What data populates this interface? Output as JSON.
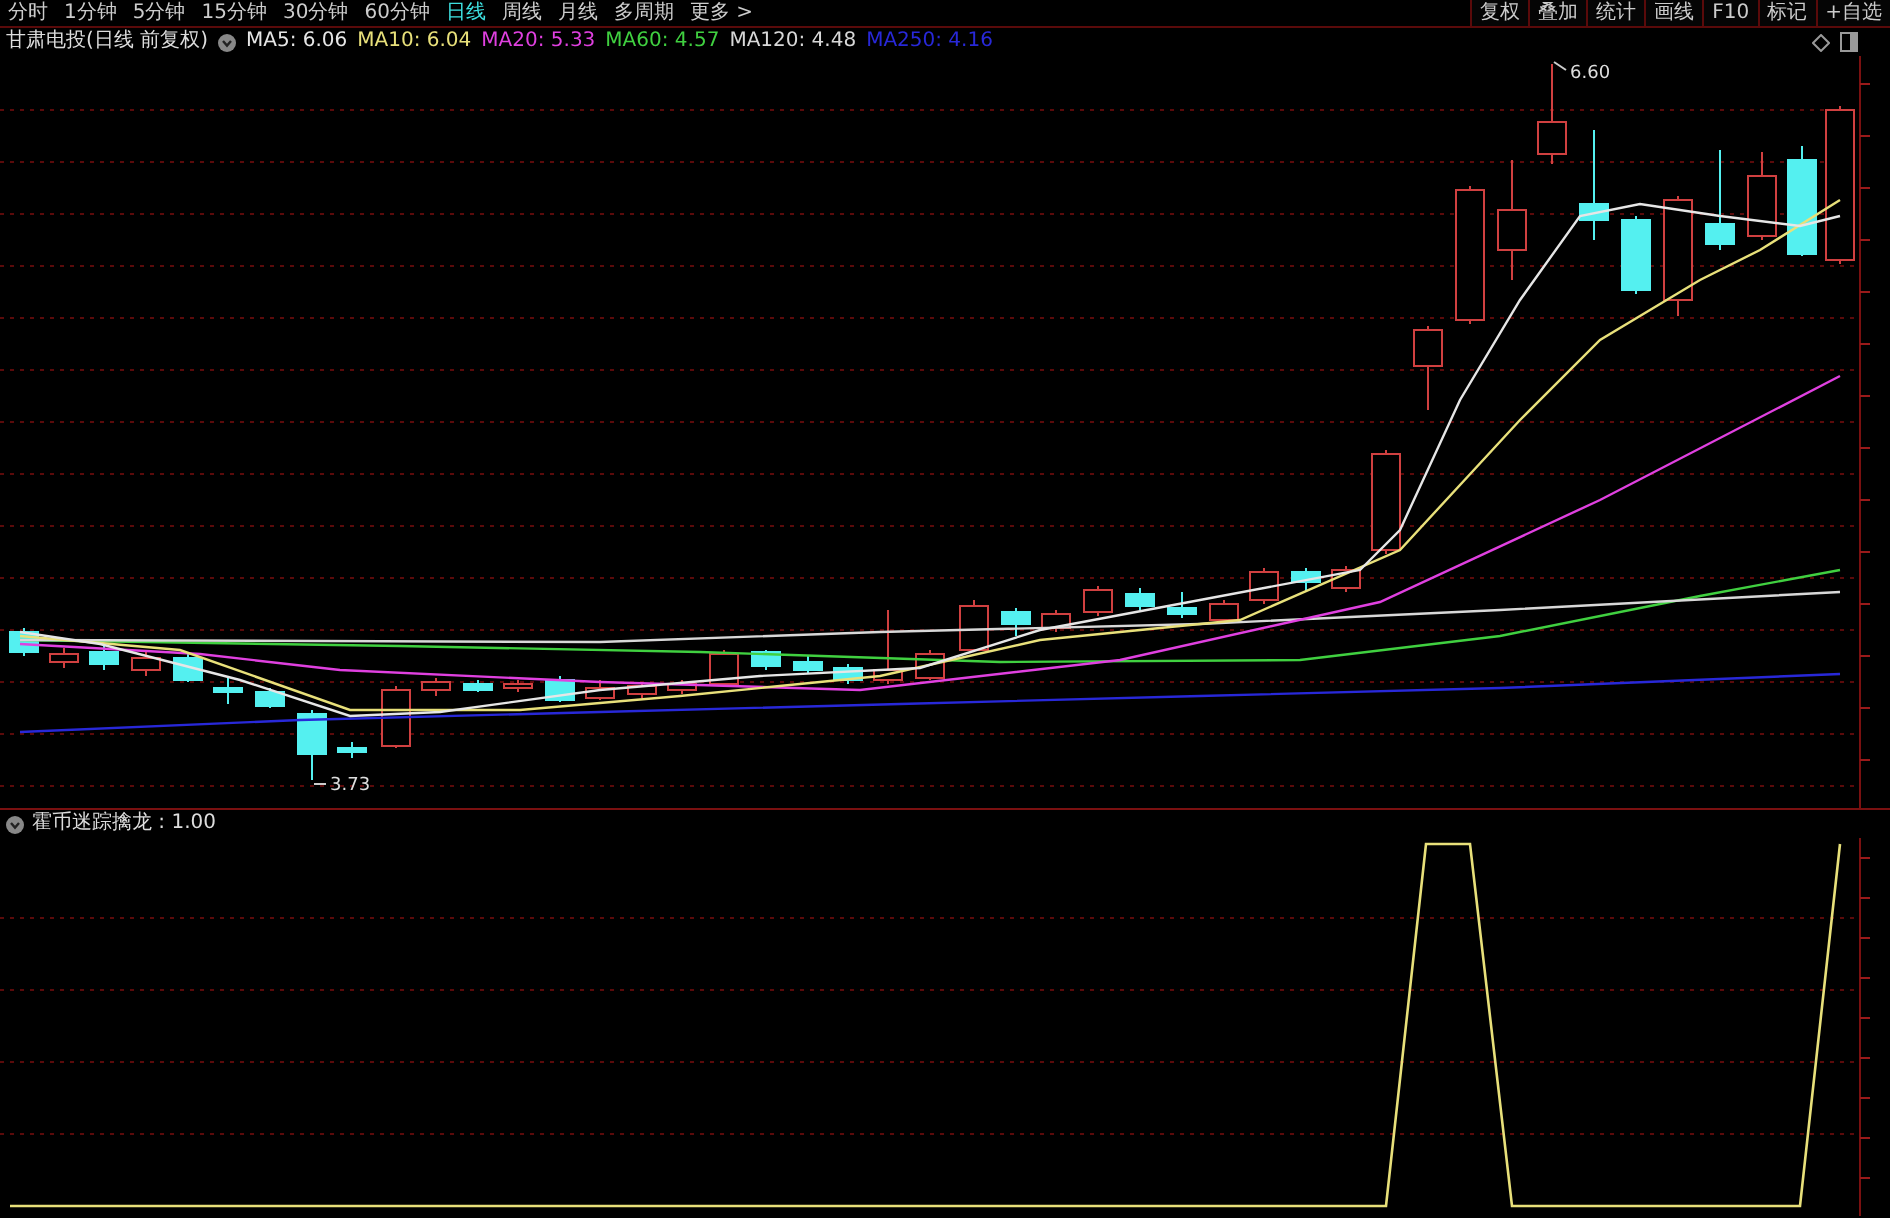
{
  "toolbar": {
    "periods": [
      {
        "label": "分时",
        "selected": false
      },
      {
        "label": "1分钟",
        "selected": false
      },
      {
        "label": "5分钟",
        "selected": false
      },
      {
        "label": "15分钟",
        "selected": false
      },
      {
        "label": "30分钟",
        "selected": false
      },
      {
        "label": "60分钟",
        "selected": false
      },
      {
        "label": "日线",
        "selected": true
      },
      {
        "label": "周线",
        "selected": false
      },
      {
        "label": "月线",
        "selected": false
      },
      {
        "label": "多周期",
        "selected": false
      },
      {
        "label": "更多 >",
        "selected": false
      }
    ],
    "buttons": [
      "复权",
      "叠加",
      "统计",
      "画线",
      "F10",
      "标记",
      "+自选"
    ]
  },
  "legend": {
    "title": "甘肃电投(日线 前复权)",
    "averages": [
      {
        "label": "MA5: 6.06",
        "color": "#e6e6e6"
      },
      {
        "label": "MA10: 6.04",
        "color": "#e8e07a"
      },
      {
        "label": "MA20: 5.33",
        "color": "#e040e0"
      },
      {
        "label": "MA60: 4.57",
        "color": "#40d040"
      },
      {
        "label": "MA120: 4.48",
        "color": "#d8d8d8"
      },
      {
        "label": "MA250: 4.16",
        "color": "#2828d8"
      }
    ]
  },
  "chart": {
    "high_label": "6.60",
    "low_label": "3.73"
  },
  "indicator": {
    "title": "霍币迷踪擒龙 : 1.00"
  }
}
